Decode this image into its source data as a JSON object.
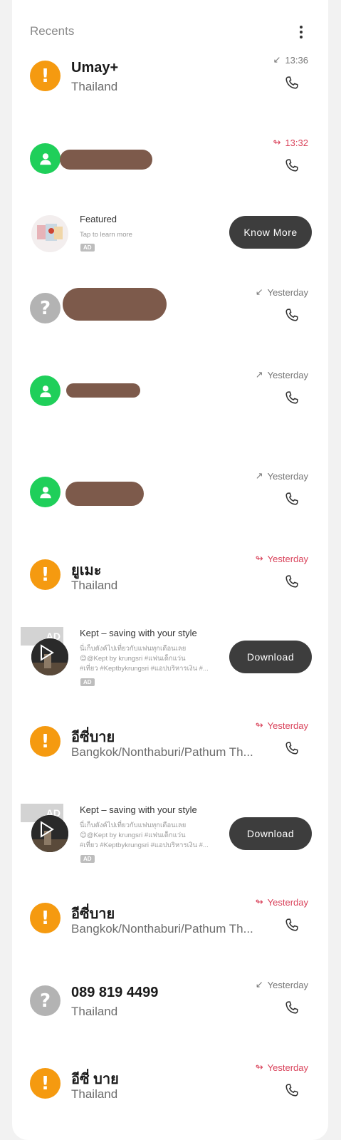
{
  "header": {
    "title": "Recents",
    "menu_icon": "more-vertical-icon"
  },
  "colors": {
    "missed": "#d9425a",
    "orange_avatar": "#f59a10",
    "green_avatar": "#1fcf5a",
    "gray_avatar": "#b3b3b3",
    "ad_button": "#3d3d3d"
  },
  "calls": [
    {
      "name": "Umay+",
      "sub": "Thailand",
      "time": "13:36",
      "type": "incoming"
    },
    {
      "name": "",
      "sub": "",
      "time": "13:32",
      "type": "missed"
    },
    {
      "name": "",
      "sub": "",
      "time": "Yesterday",
      "type": "incoming"
    },
    {
      "name": "",
      "sub": "",
      "time": "Yesterday",
      "type": "outgoing"
    },
    {
      "name": "",
      "sub": "",
      "time": "Yesterday",
      "type": "outgoing"
    },
    {
      "name": "ยูเมะ",
      "sub": "Thailand",
      "time": "Yesterday",
      "type": "missed"
    },
    {
      "name": "อีซี่บาย",
      "sub": "Bangkok/Nonthaburi/Pathum Th...",
      "time": "Yesterday",
      "type": "missed"
    },
    {
      "name": "อีซี่บาย",
      "sub": "Bangkok/Nonthaburi/Pathum Th...",
      "time": "Yesterday",
      "type": "missed"
    },
    {
      "name": "089 819 4499",
      "sub": "Thailand",
      "time": "Yesterday",
      "type": "incoming"
    },
    {
      "name": "อีซี่ บาย",
      "sub": "Thailand",
      "time": "Yesterday",
      "type": "missed"
    }
  ],
  "ads": {
    "featured": {
      "title": "Featured",
      "desc": "Tap to learn more",
      "badge": "AD",
      "button": "Know More"
    },
    "kept1": {
      "mark": "AD",
      "title": "Kept – saving with your style",
      "desc1": "นี่เก็บตังค์ไปเที่ยวกับแฟนทุกเดือนเลย",
      "desc2": "😊@Kept by krungsri #แฟนเด็กแว่น",
      "desc3": "#เที่ยว #Keptbykrungsri #แอปบริหารเงิน #...",
      "badge": "AD",
      "button": "Download"
    },
    "kept2": {
      "mark": "AD",
      "title": "Kept – saving with your style",
      "desc1": "นี่เก็บตังค์ไปเที่ยวกับแฟนทุกเดือนเลย",
      "desc2": "😊@Kept by krungsri #แฟนเด็กแว่น",
      "desc3": "#เที่ยว #Keptbykrungsri #แอปบริหารเงิน #...",
      "badge": "AD",
      "button": "Download"
    }
  }
}
